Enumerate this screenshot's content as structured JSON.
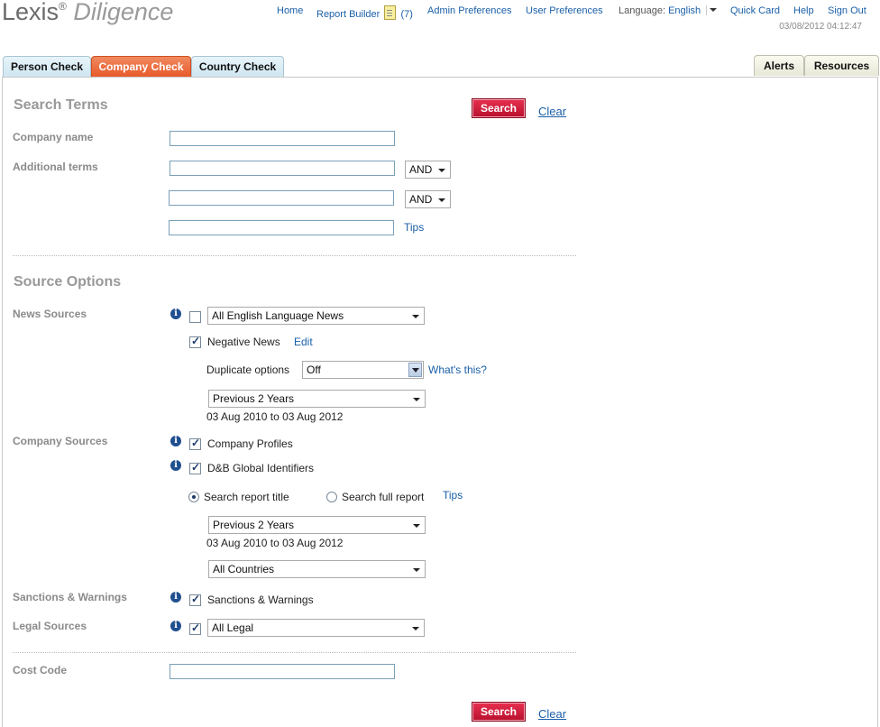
{
  "header": {
    "logo_lexis": "Lexis",
    "logo_reg": "®",
    "logo_diligence": "Diligence",
    "nav": {
      "home": "Home",
      "report_builder": "Report Builder",
      "report_count": "(7)",
      "admin_prefs": "Admin Preferences",
      "user_prefs": "User Preferences",
      "language_label": "Language:",
      "language_value": "English",
      "quick_card": "Quick Card",
      "help": "Help",
      "sign_out": "Sign Out"
    },
    "timestamp": "03/08/2012 04:12:47"
  },
  "tabs": {
    "person_check": "Person Check",
    "company_check": "Company Check",
    "country_check": "Country Check",
    "alerts": "Alerts",
    "resources": "Resources"
  },
  "search_terms": {
    "title": "Search Terms",
    "search_button": "Search",
    "clear_link": "Clear",
    "company_name_label": "Company name",
    "additional_terms_label": "Additional terms",
    "operator_1": "AND",
    "operator_2": "AND",
    "tips_link": "Tips"
  },
  "source_options": {
    "title": "Source Options",
    "news_sources": {
      "label": "News Sources",
      "source_select": "All English Language News",
      "negative_news": "Negative News",
      "edit_link": "Edit",
      "duplicate_label": "Duplicate options",
      "duplicate_value": "Off",
      "whats_this": "What's this?",
      "date_range": "Previous 2 Years",
      "date_text": "03 Aug 2010 to 03 Aug 2012"
    },
    "company_sources": {
      "label": "Company Sources",
      "company_profiles": "Company Profiles",
      "dnb": "D&B Global Identifiers",
      "search_title": "Search report title",
      "search_full": "Search full report",
      "tips_link": "Tips",
      "date_range": "Previous 2 Years",
      "date_text": "03 Aug 2010 to 03 Aug 2012",
      "country_select": "All Countries"
    },
    "sanctions": {
      "label": "Sanctions & Warnings",
      "checkbox_label": "Sanctions & Warnings"
    },
    "legal": {
      "label": "Legal Sources",
      "select": "All Legal"
    }
  },
  "cost_code": {
    "label": "Cost Code",
    "search_button": "Search",
    "clear_link": "Clear"
  }
}
